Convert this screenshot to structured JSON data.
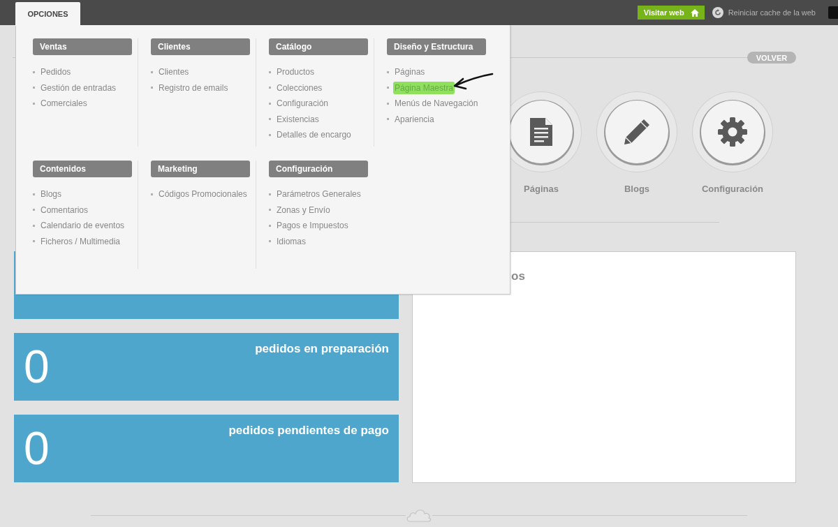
{
  "top_bar": {
    "menu_tab": {
      "label": "OPCIONES",
      "selected": true
    },
    "visit_button": "Visitar web",
    "cache_link": "Reiniciar cache de la web"
  },
  "menu": {
    "rows": [
      [
        {
          "title": "Ventas",
          "items": [
            {
              "label": "Pedidos",
              "highlighted": false
            },
            {
              "label": "Gestión de entradas",
              "highlighted": false
            },
            {
              "label": "Comerciales",
              "highlighted": false
            }
          ]
        },
        {
          "title": "Clientes",
          "items": [
            {
              "label": "Clientes",
              "highlighted": false
            },
            {
              "label": "Registro de emails",
              "highlighted": false
            }
          ]
        },
        {
          "title": "Catálogo",
          "items": [
            {
              "label": "Productos",
              "highlighted": false
            },
            {
              "label": "Colecciones",
              "highlighted": false
            },
            {
              "label": "Configuración",
              "highlighted": false
            },
            {
              "label": "Existencias",
              "highlighted": false
            },
            {
              "label": "Detalles de encargo",
              "highlighted": false
            }
          ]
        },
        {
          "title": "Diseño y Estructura",
          "items": [
            {
              "label": "Páginas",
              "highlighted": false
            },
            {
              "label": "Página Maestra",
              "highlighted": true
            },
            {
              "label": "Menús de Navegación",
              "highlighted": false
            },
            {
              "label": "Apariencia",
              "highlighted": false
            }
          ]
        }
      ],
      [
        {
          "title": "Contenidos",
          "items": [
            {
              "label": "Blogs",
              "highlighted": false
            },
            {
              "label": "Comentarios",
              "highlighted": false
            },
            {
              "label": "Calendario de eventos",
              "highlighted": false
            },
            {
              "label": "Ficheros / Multimedia",
              "highlighted": false
            }
          ]
        },
        {
          "title": "Marketing",
          "items": [
            {
              "label": "Códigos Promocionales",
              "highlighted": false
            }
          ]
        },
        {
          "title": "Configuración",
          "items": [
            {
              "label": "Parámetros Generales",
              "highlighted": false
            },
            {
              "label": "Zonas y Envío",
              "highlighted": false
            },
            {
              "label": "Pagos e Impuestos",
              "highlighted": false
            },
            {
              "label": "Idiomas",
              "highlighted": false
            }
          ]
        }
      ]
    ]
  },
  "back_button": "VOLVER",
  "shortcuts": [
    {
      "label": "Páginas",
      "kind": "document"
    },
    {
      "label": "Blogs",
      "kind": "pencil"
    },
    {
      "label": "Configuración",
      "kind": "gear"
    }
  ],
  "stat_cards": [
    {
      "kind": "stat"
    },
    {
      "kind": "stat",
      "value": "0",
      "label": "pedidos en preparación"
    },
    {
      "kind": "stat",
      "value": "0",
      "label": "pedidos pendientes de pago"
    }
  ],
  "panel": {
    "title": "os"
  }
}
